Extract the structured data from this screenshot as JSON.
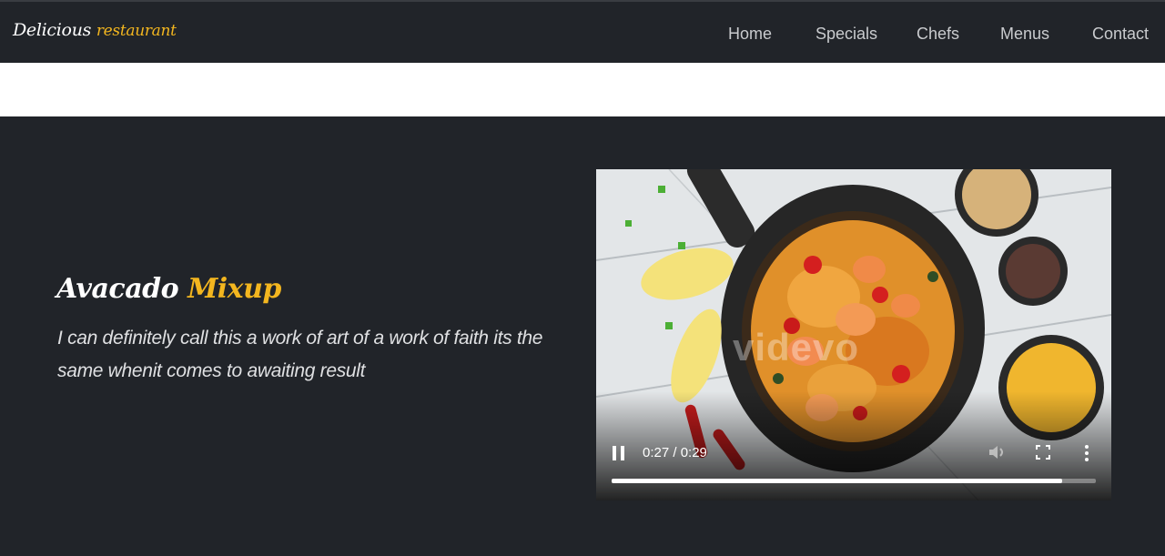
{
  "brand": {
    "name": "Delicious",
    "accent": "restaurant"
  },
  "nav": {
    "items": [
      {
        "label": "Home"
      },
      {
        "label": "Specials"
      },
      {
        "label": "Chefs"
      },
      {
        "label": "Menus"
      },
      {
        "label": "Contact"
      }
    ]
  },
  "hero": {
    "title_main": "Avacado",
    "title_accent": "Mixup",
    "description": "I can definitely call this a work of art of a work of faith its the same whenit comes to awaiting result"
  },
  "video": {
    "watermark": "videvo",
    "time_display": "0:27 / 0:29",
    "current_time": "0:27",
    "duration": "0:29",
    "progress_fraction": 0.93,
    "state": "playing"
  },
  "colors": {
    "background_dark": "#212429",
    "accent": "#f3b61f",
    "nav_text": "#c9cbce"
  }
}
